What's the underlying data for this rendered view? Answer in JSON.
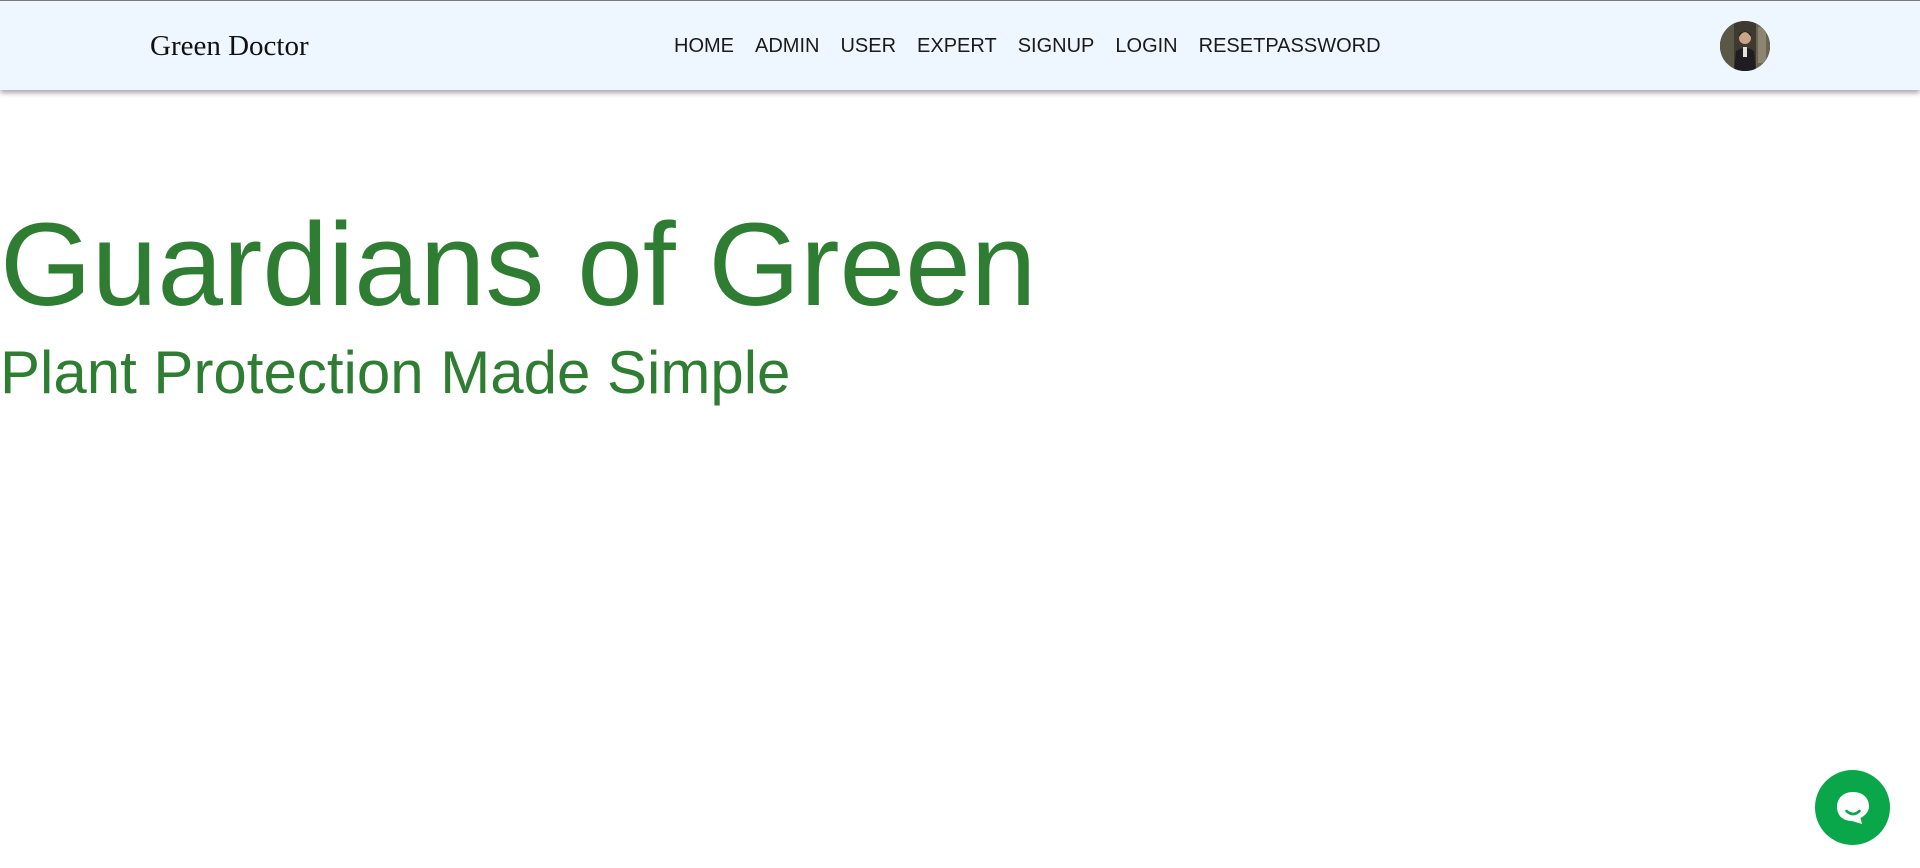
{
  "header": {
    "brand": "Green Doctor",
    "nav": [
      {
        "label": "HOME"
      },
      {
        "label": "ADMIN"
      },
      {
        "label": "USER"
      },
      {
        "label": "EXPERT"
      },
      {
        "label": "SIGNUP"
      },
      {
        "label": "LOGIN"
      },
      {
        "label": "RESETPASSWORD"
      }
    ],
    "avatar_icon": "user-avatar"
  },
  "hero": {
    "title": "Guardians of Green",
    "subtitle": "Plant Protection Made Simple"
  },
  "chat": {
    "icon": "chat-bubble-icon"
  },
  "colors": {
    "header_bg": "#eef6ff",
    "brand_text": "#111111",
    "hero_text": "#2e7d32",
    "chat_button": "#0aa64a"
  }
}
